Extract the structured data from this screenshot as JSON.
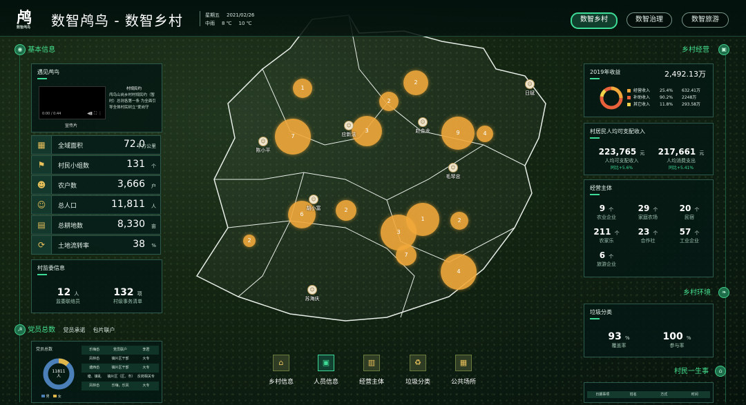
{
  "header": {
    "title": "数智鸬鸟 - 数智乡村",
    "logo_text": "鸬",
    "logo_sub": "数智鸬鸟",
    "weekday": "星期五",
    "date": "2021/02/26",
    "weather": "中雨",
    "temp_low": "8 ℃",
    "temp_high": "10 ℃",
    "nav": [
      "数智乡村",
      "数智治理",
      "数智旅游"
    ]
  },
  "left": {
    "basic_title": "基本信息",
    "village_panel_title": "遇见鸬鸟",
    "video_time": "0:00 / 0:44",
    "video_caption": "宣传片",
    "notice_title": "村规民约",
    "notice_text": "鸬鸟山岗乡村村规民约（暂时）总则各第一条 为全面引导全体村民树立\"爱岗守",
    "stats": [
      {
        "icon": "area-icon",
        "label": "全域面积",
        "value": "72.0",
        "unit": "平方公里"
      },
      {
        "icon": "flag-icon",
        "label": "村民小组数",
        "value": "131",
        "unit": "个"
      },
      {
        "icon": "farmer-icon",
        "label": "农户数",
        "value": "3,666",
        "unit": "户"
      },
      {
        "icon": "population-icon",
        "label": "总人口",
        "value": "11,811",
        "unit": "人"
      },
      {
        "icon": "farmland-icon",
        "label": "总耕地数",
        "value": "8,330",
        "unit": "亩"
      },
      {
        "icon": "land-transfer-icon",
        "label": "土地流转率",
        "value": "38",
        "unit": "%"
      }
    ],
    "committee_title": "村监委信息",
    "committee": [
      {
        "value": "12",
        "unit": "人",
        "label": "监委联络员"
      },
      {
        "value": "132",
        "unit": "项",
        "label": "村级事务清单"
      }
    ],
    "party_title": "党员总数",
    "party_tabs": [
      "党员承诺",
      "包片联户"
    ],
    "party_panel_title": "党员总数",
    "party_total": "11811",
    "party_total_unit": "人",
    "party_legend": [
      "男",
      "女"
    ],
    "party_rows": [
      [
        "乐嗨岙",
        "党员联户",
        "李君"
      ],
      [
        "凤林岙",
        "镇片区干部",
        "大专"
      ],
      [
        "塘西岙",
        "镇片区干部",
        "大专"
      ],
      [
        "塘、镇乱",
        "镇片区（区、市）",
        "反岗相关专"
      ],
      [
        "凤林岙",
        "乐嗨，乐凤",
        "大专"
      ]
    ]
  },
  "right": {
    "economy_title": "乡村经营",
    "income_title": "2019年收益",
    "income_total": "2,492.13万",
    "income_legend": [
      {
        "label": "经营收入",
        "pct": "25.4%",
        "val": "632.41万",
        "color": "#f2a93b"
      },
      {
        "label": "补助收入",
        "pct": "90.2%",
        "val": "2248万",
        "color": "#e8613a"
      },
      {
        "label": "其它收入",
        "pct": "11.8%",
        "val": "293.58万",
        "color": "#f0d34a"
      }
    ],
    "disposable_title": "村居民人均可支配收入",
    "disposable": [
      {
        "value": "223,765",
        "unit": "元",
        "label": "人均可支配收入",
        "yoy": "同比+5.6%"
      },
      {
        "value": "217,661",
        "unit": "元",
        "label": "人均消费支出",
        "yoy": "同比+5.41%"
      }
    ],
    "entity_title": "经营主体",
    "entities": [
      {
        "value": "9",
        "unit": "个",
        "label": "农业企业"
      },
      {
        "value": "29",
        "unit": "个",
        "label": "家庭农场"
      },
      {
        "value": "20",
        "unit": "个",
        "label": "民宿"
      },
      {
        "value": "211",
        "unit": "个",
        "label": "农家乐"
      },
      {
        "value": "23",
        "unit": "个",
        "label": "合作社"
      },
      {
        "value": "57",
        "unit": "个",
        "label": "工业企业"
      },
      {
        "value": "6",
        "unit": "个",
        "label": "旅游企业"
      }
    ],
    "env_title": "乡村环境",
    "garbage_title": "垃圾分类",
    "garbage": [
      {
        "value": "93",
        "unit": "%",
        "label": "覆盖率"
      },
      {
        "value": "100",
        "unit": "%",
        "label": "参与率"
      }
    ],
    "events_title": "村民一生事",
    "events_cols": [
      "日期事项",
      "姓名",
      "方式",
      "时间"
    ]
  },
  "map": {
    "villages": [
      "日斌",
      "应新法",
      "赵金龙",
      "陈小平",
      "毛琴忠",
      "胡小富",
      "苏海庆"
    ],
    "clusters": [
      "1",
      "2",
      "2",
      "3",
      "9",
      "4",
      "7",
      "6",
      "2",
      "1",
      "2",
      "2",
      "3",
      "7",
      "4"
    ]
  },
  "bottom_nav": [
    {
      "icon": "village-icon",
      "label": "乡村信息"
    },
    {
      "icon": "person-card-icon",
      "label": "人员信息"
    },
    {
      "icon": "business-icon",
      "label": "经营主体"
    },
    {
      "icon": "trash-icon",
      "label": "垃圾分类"
    },
    {
      "icon": "building-icon",
      "label": "公共场所"
    }
  ],
  "colors": {
    "accent": "#3ddc97",
    "cluster": "#f2a93b",
    "panel": "#05181a"
  }
}
